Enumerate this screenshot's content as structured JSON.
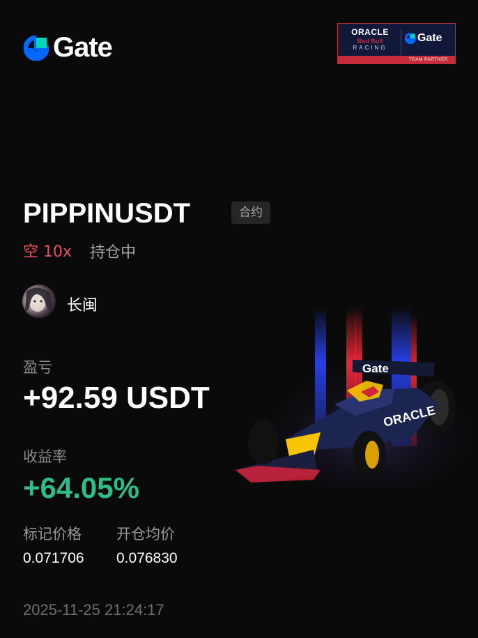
{
  "brand": {
    "name": "Gate",
    "color": "#0068ff",
    "accent": "#00d6b9"
  },
  "partner": {
    "oracle": "ORACLE",
    "redbull": "Red Bull",
    "racing": "RACING",
    "gate": "Gate",
    "bar_text": "TEAM PARTNER"
  },
  "position": {
    "pair": "PIPPINUSDT",
    "tag": "合约",
    "side": "空 10x",
    "status": "持仓中",
    "side_color": "#ef4e5d"
  },
  "user": {
    "name": "长闽"
  },
  "stats": {
    "pnl_label": "盈亏",
    "pnl_value": "+92.59 USDT",
    "roi_label": "收益率",
    "roi_value": "+64.05%",
    "roi_color": "#2fbd85",
    "mark_label": "标记价格",
    "mark_value": "0.071706",
    "entry_label": "开仓均价",
    "entry_value": "0.076830"
  },
  "timestamp": "2025-11-25 21:24:17",
  "car": {
    "wing_text": "Gate",
    "sidepod_text": "ORACLE"
  }
}
